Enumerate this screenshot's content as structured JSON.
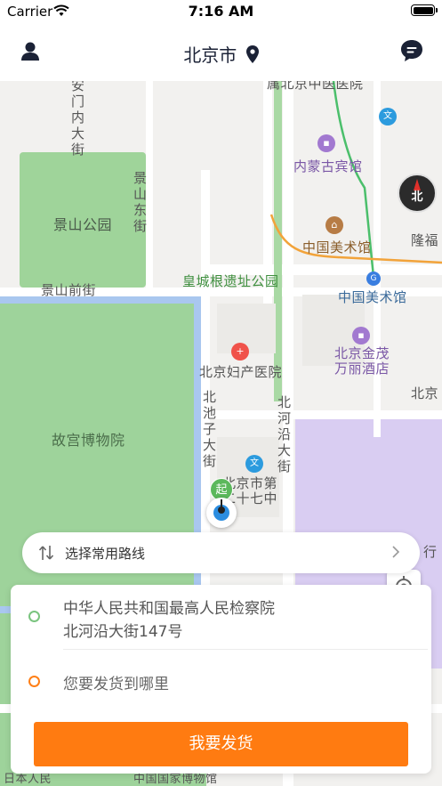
{
  "status_bar": {
    "carrier": "Carrier",
    "time": "7:16 AM"
  },
  "nav": {
    "title": "北京市",
    "left_icon": "user-icon",
    "right_icon": "chat-icon",
    "title_icon": "location-pin-icon"
  },
  "map": {
    "labels": {
      "beijing_tcm_hospital": "属北京中医医院",
      "anmen_street": "安门内大街",
      "jingshan_east_street": "景山东街",
      "neimeng_hotel": "内蒙古宾馆",
      "jingshan_park": "景山公园",
      "china_art_museum": "中国美术馆",
      "longfu": "隆福",
      "jingshan_front_street": "景山前街",
      "huangcheng_park": "皇城根遗址公园",
      "china_art_museum_station": "中国美术馆",
      "maternity_hospital": "北京妇产医院",
      "jinmao_hotel": "北京金茂万丽酒店",
      "beijing_short": "北京",
      "beichi_street": "北池子大街",
      "beiheyan_street": "北河沿大街",
      "palace_museum": "故宫博物院",
      "school27": "北京市第二十七中学",
      "hang": "行",
      "national_museum": "中国国家博物馆",
      "bottom_left": "日本人民"
    },
    "compass_label": "北",
    "start_marker_label": "起"
  },
  "route_selector": {
    "label": "选择常用路线"
  },
  "address_card": {
    "from_name": "中华人民共和国最高人民检察院",
    "from_detail": "北河沿大街147号",
    "to_placeholder": "您要发货到哪里",
    "ship_button": "我要发货"
  },
  "colors": {
    "accent": "#ff7b11",
    "start_green": "#7ac47f",
    "end_orange": "#ff7f16",
    "nav_text": "#1b2236"
  }
}
